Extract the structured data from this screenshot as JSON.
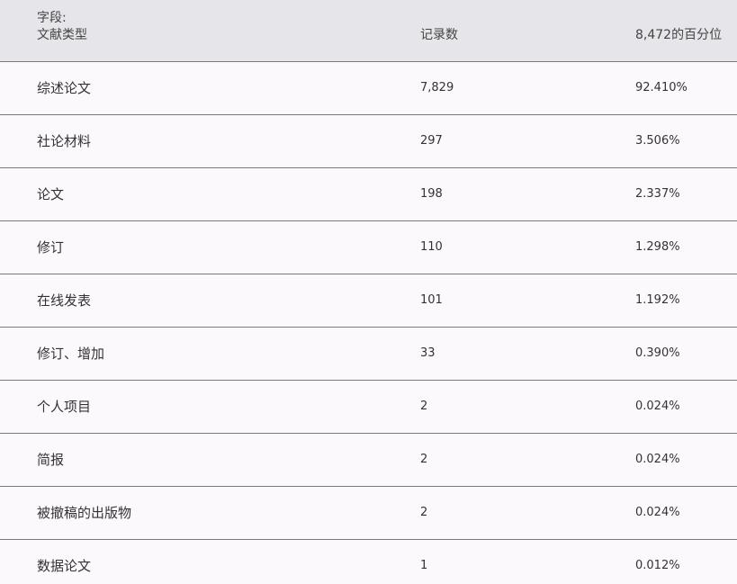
{
  "header": {
    "field_label": "字段:",
    "col_name": "文献类型",
    "col_count": "记录数",
    "col_pct": "8,472的百分位"
  },
  "rows": [
    {
      "name": "综述论文",
      "count": "7,829",
      "pct": "92.410%"
    },
    {
      "name": "社论材料",
      "count": "297",
      "pct": "3.506%"
    },
    {
      "name": "论文",
      "count": "198",
      "pct": "2.337%"
    },
    {
      "name": "修订",
      "count": "110",
      "pct": "1.298%"
    },
    {
      "name": "在线发表",
      "count": "101",
      "pct": "1.192%"
    },
    {
      "name": "修订、增加",
      "count": "33",
      "pct": "0.390%"
    },
    {
      "name": "个人项目",
      "count": "2",
      "pct": "0.024%"
    },
    {
      "name": "简报",
      "count": "2",
      "pct": "0.024%"
    },
    {
      "name": "被撤稿的出版物",
      "count": "2",
      "pct": "0.024%"
    },
    {
      "name": "数据论文",
      "count": "1",
      "pct": "0.012%"
    }
  ]
}
